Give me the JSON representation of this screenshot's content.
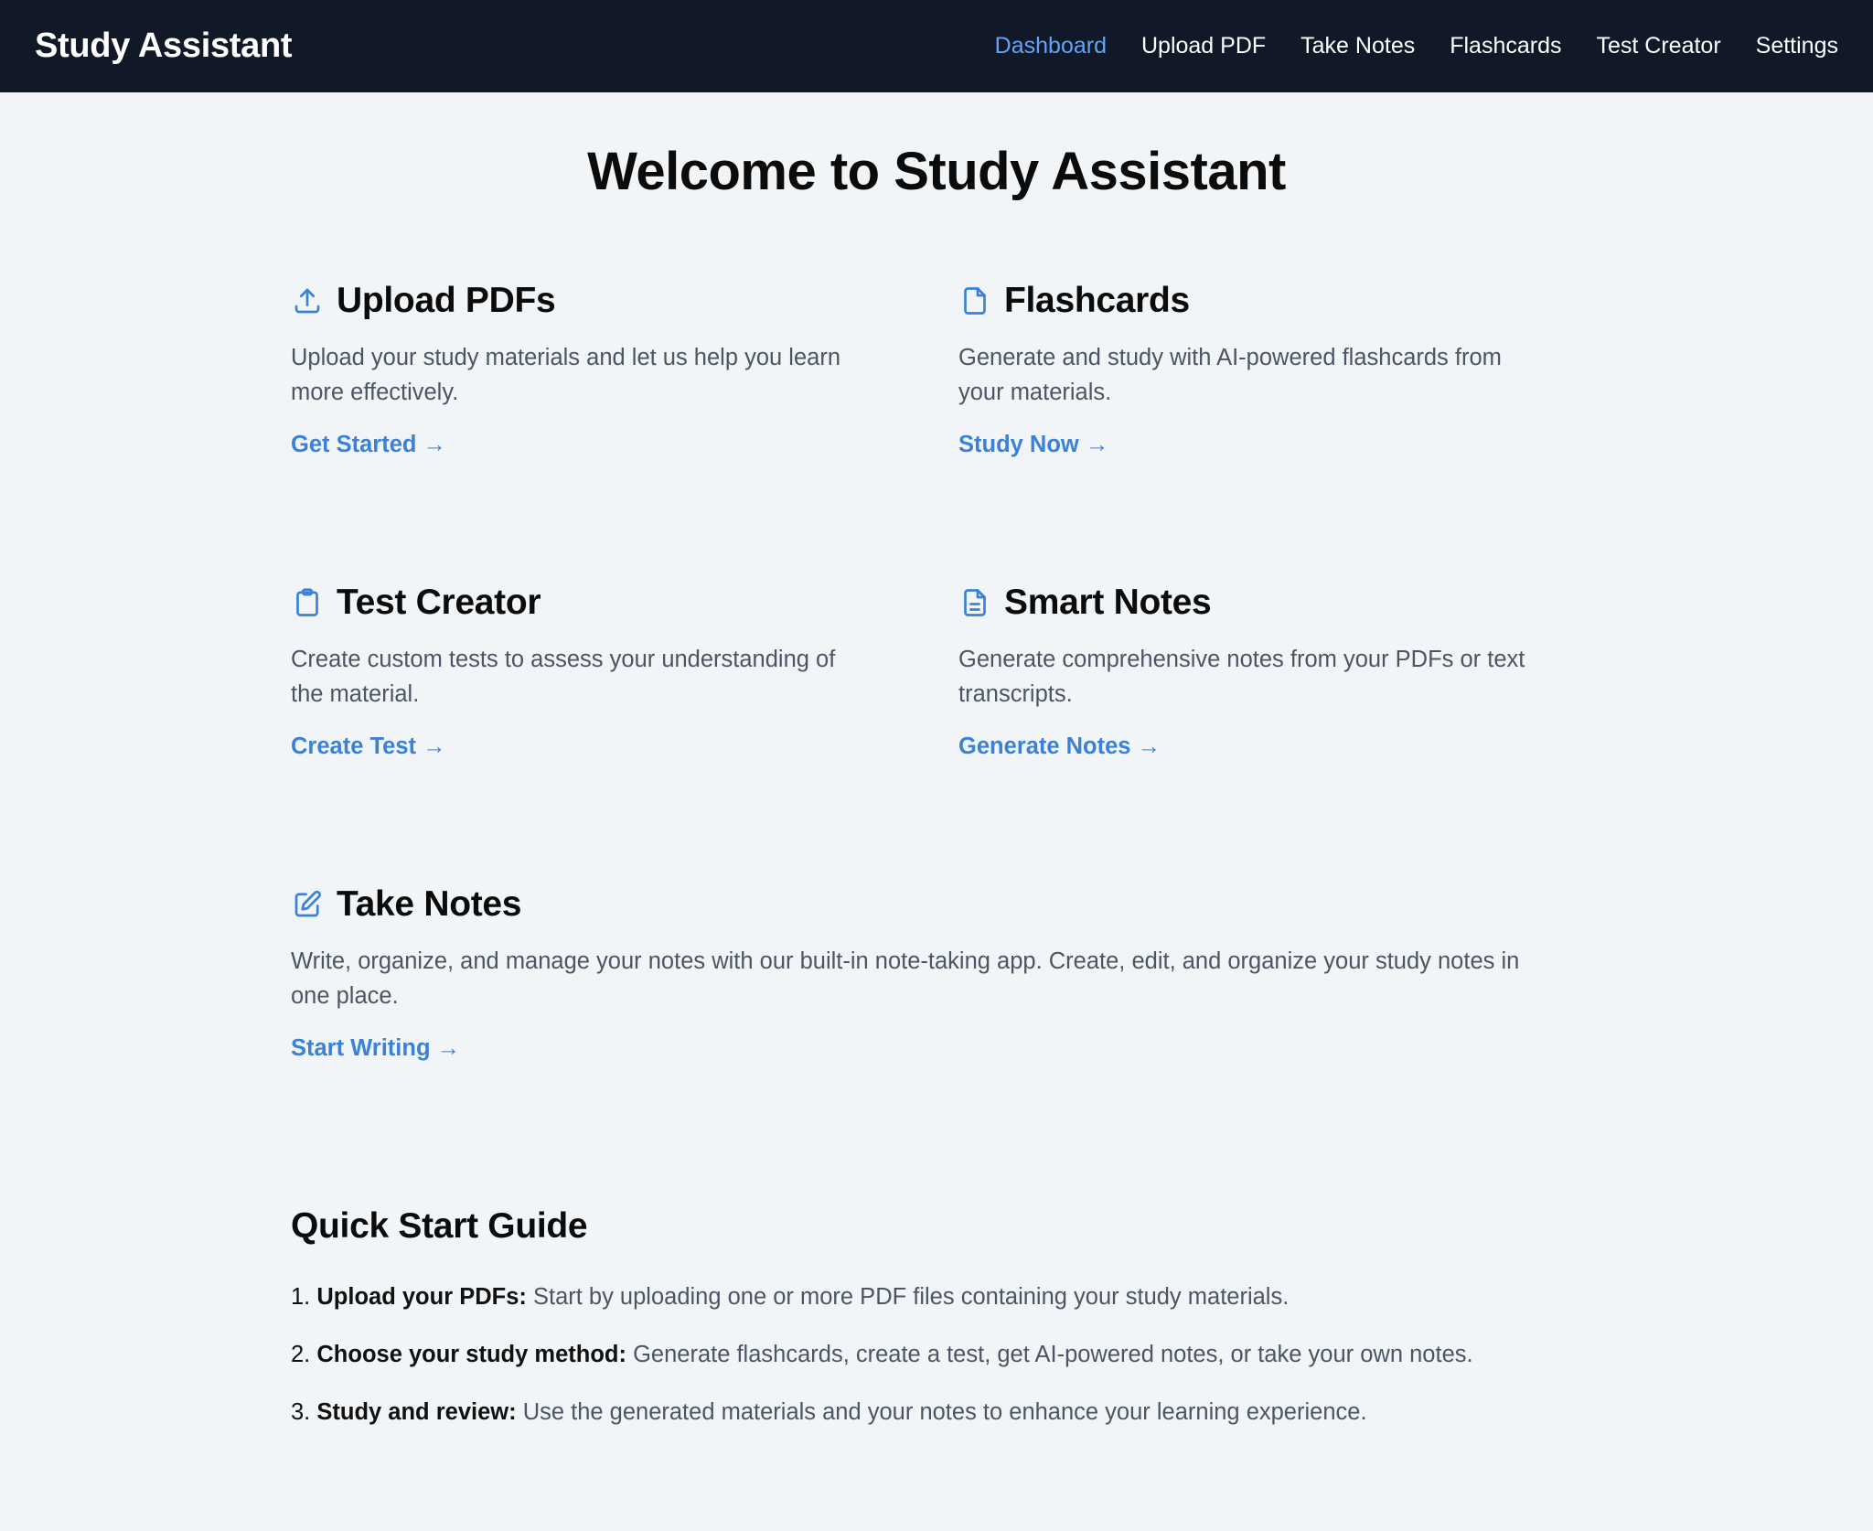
{
  "app": {
    "brand": "Study Assistant"
  },
  "nav": [
    {
      "label": "Dashboard",
      "active": true
    },
    {
      "label": "Upload PDF",
      "active": false
    },
    {
      "label": "Take Notes",
      "active": false
    },
    {
      "label": "Flashcards",
      "active": false
    },
    {
      "label": "Test Creator",
      "active": false
    },
    {
      "label": "Settings",
      "active": false
    }
  ],
  "page": {
    "title": "Welcome to Study Assistant"
  },
  "cards": [
    {
      "icon": "upload-icon",
      "title": "Upload PDFs",
      "description": "Upload your study materials and let us help you learn more effectively.",
      "link": "Get Started →"
    },
    {
      "icon": "document-icon",
      "title": "Flashcards",
      "description": "Generate and study with AI-powered flashcards from your materials.",
      "link": "Study Now →"
    },
    {
      "icon": "clipboard-icon",
      "title": "Test Creator",
      "description": "Create custom tests to assess your understanding of the material.",
      "link": "Create Test →"
    },
    {
      "icon": "document-text-icon",
      "title": "Smart Notes",
      "description": "Generate comprehensive notes from your PDFs or text transcripts.",
      "link": "Generate Notes →"
    },
    {
      "icon": "pencil-square-icon",
      "title": "Take Notes",
      "description": "Write, organize, and manage your notes with our built-in note-taking app. Create, edit, and organize your study notes in one place.",
      "link": "Start Writing →"
    }
  ],
  "guide": {
    "title": "Quick Start Guide",
    "steps": [
      {
        "num": "1.",
        "label": "Upload your PDFs:",
        "text": " Start by uploading one or more PDF files containing your study materials."
      },
      {
        "num": "2.",
        "label": "Choose your study method:",
        "text": " Generate flashcards, create a test, get AI-powered notes, or take your own notes."
      },
      {
        "num": "3.",
        "label": "Study and review:",
        "text": " Use the generated materials and your notes to enhance your learning experience."
      }
    ]
  },
  "colors": {
    "navbar": "#111827",
    "accent": "#3b82d6",
    "nav_active": "#60a5fa",
    "background": "#f2f5f7"
  }
}
